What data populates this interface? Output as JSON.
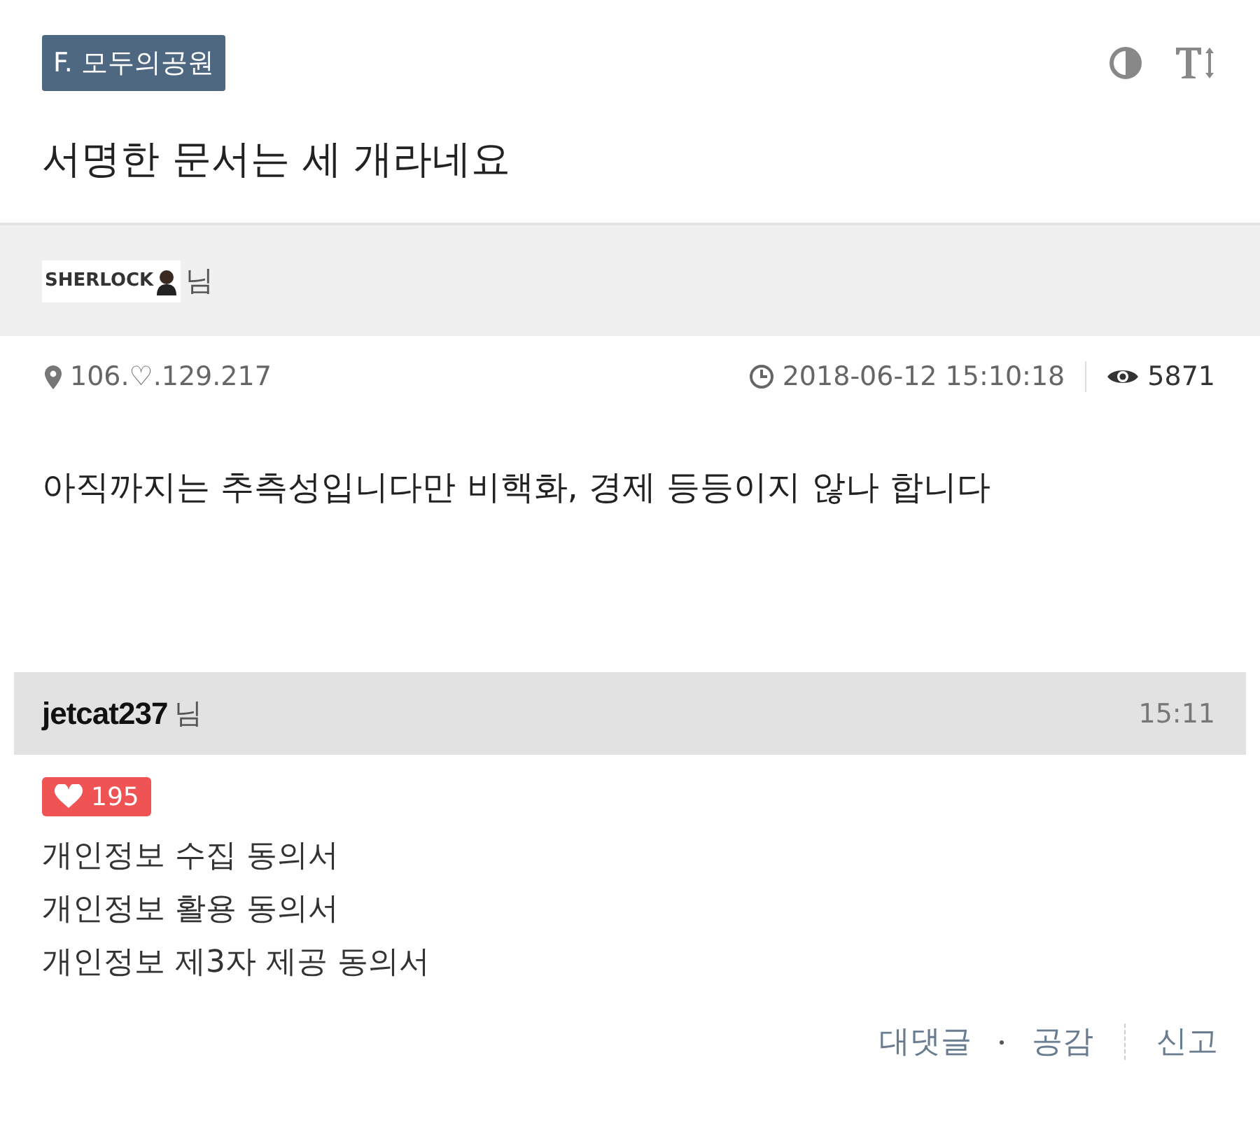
{
  "board_badge": "F. 모두의공원",
  "title": "서명한 문서는 세 개라네요",
  "author": {
    "nick": "SHERLOCK",
    "suffix": "님"
  },
  "meta": {
    "ip": "106.♡.129.217",
    "datetime": "2018-06-12 15:10:18",
    "views": "5871"
  },
  "body": "아직까지는 추측성입니다만 비핵화, 경제 등등이지 않나 합니다",
  "comment": {
    "author": "jetcat237",
    "suffix": "님",
    "time": "15:11",
    "likes": "195",
    "lines": [
      "개인정보 수집 동의서",
      "개인정보 활용 동의서",
      "개인정보 제3자 제공 동의서"
    ],
    "actions": [
      "대댓글",
      "공감",
      "신고"
    ]
  }
}
